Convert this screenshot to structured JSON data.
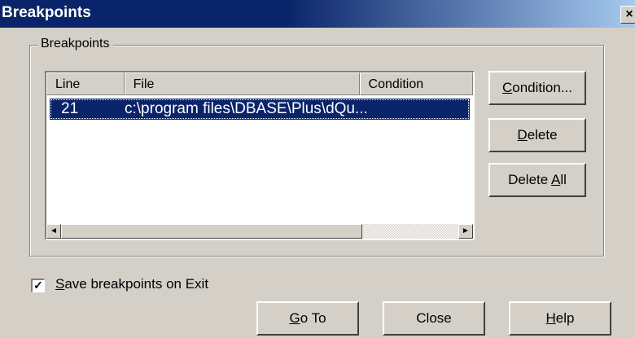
{
  "window": {
    "title": "Breakpoints",
    "close_glyph": "×"
  },
  "group": {
    "label": "Breakpoints"
  },
  "list": {
    "columns": [
      "Line",
      "File",
      "Condition"
    ],
    "rows": [
      {
        "line": "21",
        "file": "c:\\program files\\DBASE\\Plus\\dQu...",
        "condition": ""
      }
    ],
    "scroll_left_glyph": "◄",
    "scroll_right_glyph": "►"
  },
  "buttons": {
    "condition": {
      "prefix": "",
      "mnemonic": "C",
      "rest": "ondition..."
    },
    "delete": {
      "prefix": "",
      "mnemonic": "D",
      "rest": "elete"
    },
    "delete_all": {
      "prefix": "Delete ",
      "mnemonic": "A",
      "rest": "ll"
    },
    "go_to": {
      "prefix": "",
      "mnemonic": "G",
      "rest": "o To"
    },
    "close": "Close",
    "help": {
      "prefix": "",
      "mnemonic": "H",
      "rest": "elp"
    }
  },
  "save_option": {
    "checked": true,
    "check_glyph": "✓",
    "label_mnemonic": "S",
    "label_rest": "ave breakpoints on Exit"
  }
}
